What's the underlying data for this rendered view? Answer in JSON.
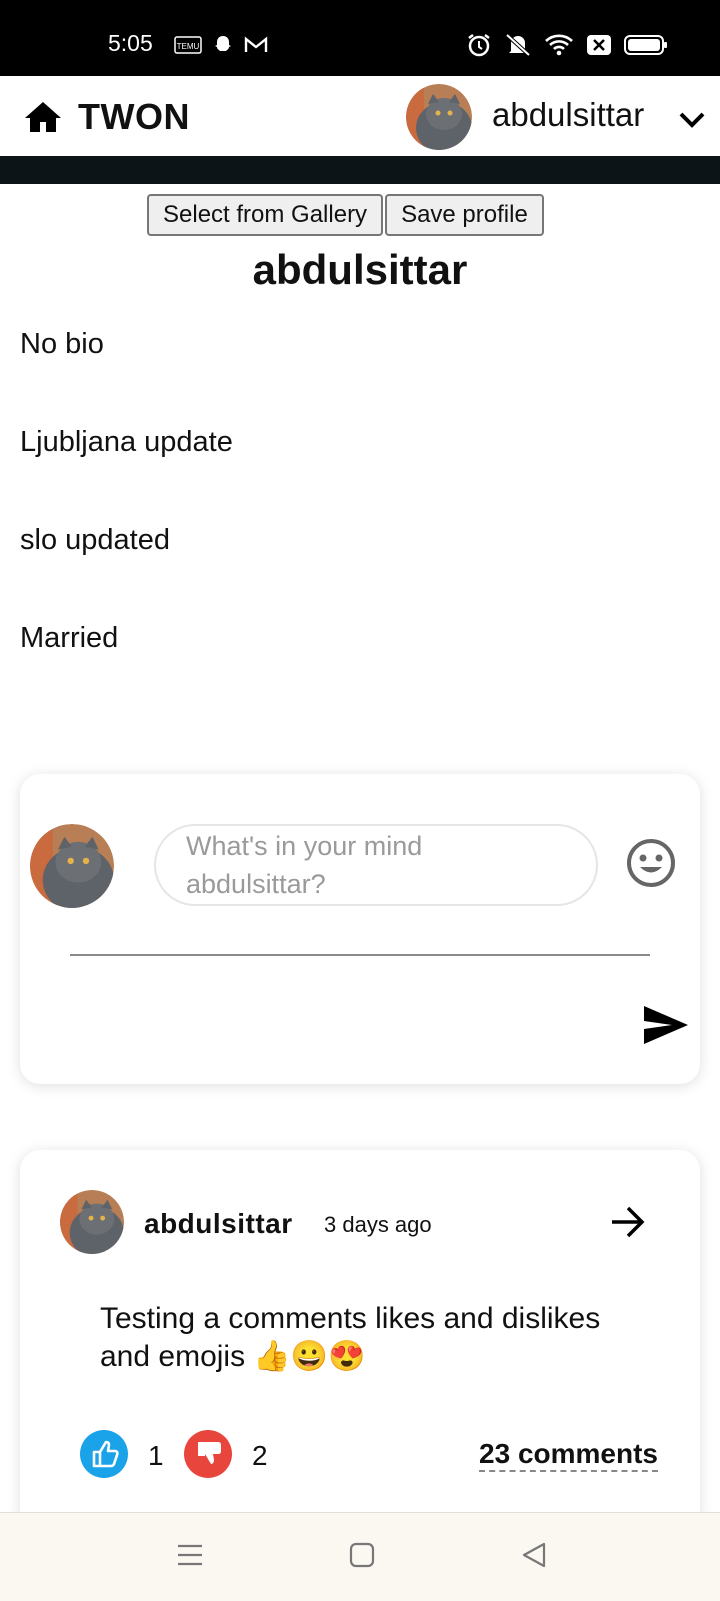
{
  "status_bar": {
    "time": "5:05",
    "left_icons": [
      "temu-icon",
      "snapchat-icon",
      "gmail-icon"
    ],
    "right_icons": [
      "alarm-icon",
      "mute-icon",
      "wifi-icon",
      "close-box-icon",
      "battery-icon"
    ]
  },
  "app_bar": {
    "brand": "TWON",
    "username": "abdulsittar"
  },
  "profile": {
    "buttons": {
      "gallery": "Select from Gallery",
      "save": "Save profile"
    },
    "name": "abdulsittar",
    "info": [
      "No bio",
      "Ljubljana update",
      "slo updated",
      "Married"
    ]
  },
  "composer": {
    "placeholder": "What's in your mind abdulsittar?"
  },
  "post": {
    "author": "abdulsittar",
    "time": "3 days ago",
    "text": "Testing a comments likes and dislikes and emojis 👍😀😍",
    "likes": "1",
    "dislikes": "2",
    "comments": "23 comments"
  },
  "colors": {
    "like": "#1aa3e8",
    "dislike": "#e8453c",
    "header_dark": "#0c1418"
  }
}
